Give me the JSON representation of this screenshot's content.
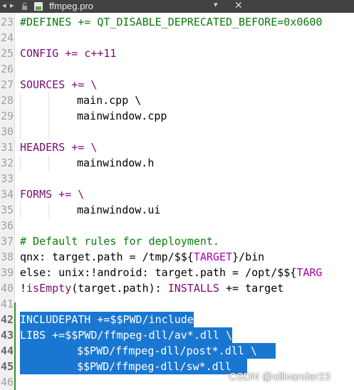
{
  "tab": {
    "file_name": "ffmpeg.pro",
    "dropdown_glyph": "▾",
    "close_glyph": "✕",
    "left_arrow": "◂",
    "right_arrow": "▸"
  },
  "editor": {
    "line_numbers": [
      "23",
      "24",
      "25",
      "26",
      "27",
      "28",
      "29",
      "30",
      "31",
      "32",
      "33",
      "34",
      "35",
      "36",
      "37",
      "38",
      "39",
      "40",
      "41",
      "42",
      "43",
      "44",
      "45",
      "46"
    ],
    "lines": {
      "l23": "#DEFINES += QT_DISABLE_DEPRECATED_BEFORE=0x0600",
      "l25": "CONFIG += c++11",
      "l27": "SOURCES += \\",
      "l28": "main.cpp \\",
      "l29": "mainwindow.cpp",
      "l31": "HEADERS += \\",
      "l32": "mainwindow.h",
      "l34": "FORMS += \\",
      "l35": "mainwindow.ui",
      "l37": "# Default rules for deployment.",
      "l38": {
        "a": "qnx: target.path = /tmp/$${",
        "b": "TARGET",
        "c": "}/bin"
      },
      "l39": {
        "a": "else: unix:!android: target.path = /opt/$${",
        "b": "TARG"
      },
      "l40": {
        "a": "!",
        "b": "isEmpty",
        "c": "(target.path): ",
        "d": "INSTALLS",
        "e": " += target"
      },
      "l42": "INCLUDEPATH +=$$PWD/include",
      "l43": "LIBS +=$$PWD/ffmpeg-dll/av*.dll \\",
      "l44": "$$PWD/ffmpeg-dll/post*.dll \\",
      "l45": "$$PWD/ffmpeg-dll/sw*.dll"
    }
  },
  "watermark": "CSDN @ollivander23",
  "colors": {
    "selection": "#1977d2",
    "tab_bar": "#404244",
    "keyword": "#7a0a7a",
    "define": "#0a7a0a"
  }
}
